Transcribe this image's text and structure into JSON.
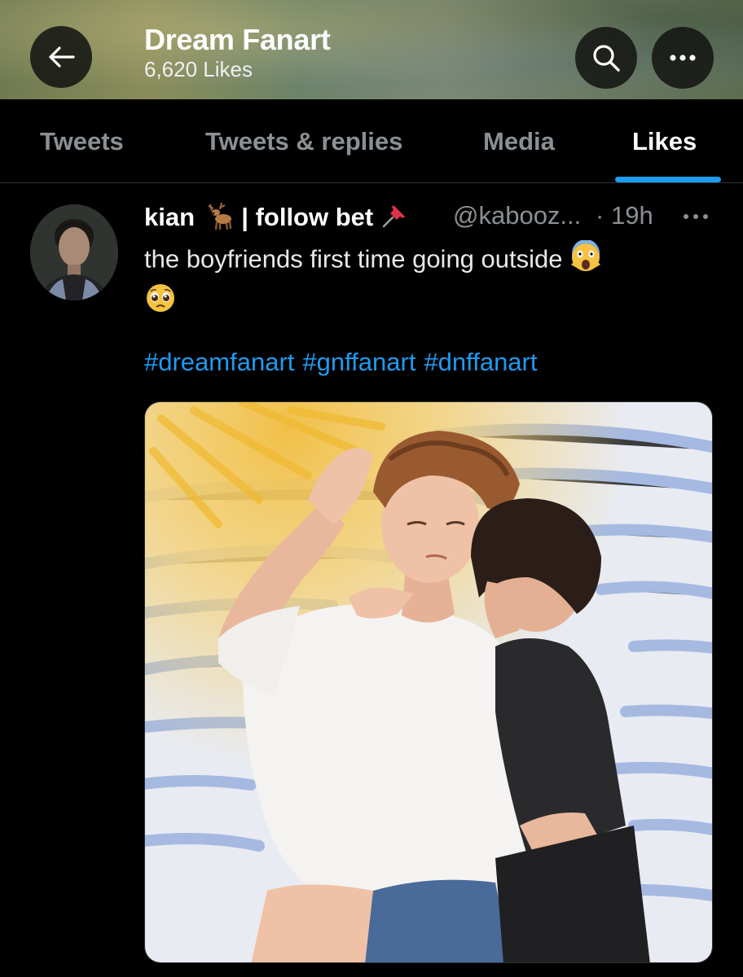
{
  "header": {
    "title": "Dream Fanart",
    "subtitle": "6,620 Likes"
  },
  "tabs": [
    {
      "label": "Tweets",
      "active": false
    },
    {
      "label": "Tweets & replies",
      "active": false
    },
    {
      "label": "Media",
      "active": false
    },
    {
      "label": "Likes",
      "active": true
    }
  ],
  "tweet": {
    "name": "kian",
    "name_suffix": "| follow bet",
    "handle": "@kabooz...",
    "separator": "·",
    "time": "19h",
    "text": "the boyfriends first time going outside",
    "hashtags": [
      "#dreamfanart",
      "#gnffanart",
      "#dnffanart"
    ]
  },
  "icons": {
    "back": "arrow-left-icon",
    "search": "search-icon",
    "more": "more-horizontal-icon",
    "name_emoji_1": "deer-emoji",
    "name_emoji_2": "pushpin-emoji",
    "text_emoji_1": "screaming-face-emoji",
    "text_emoji_2": "pleading-face-emoji"
  },
  "colors": {
    "accent": "#1d9bf0",
    "background": "#000000",
    "muted_text": "#8b9094"
  }
}
